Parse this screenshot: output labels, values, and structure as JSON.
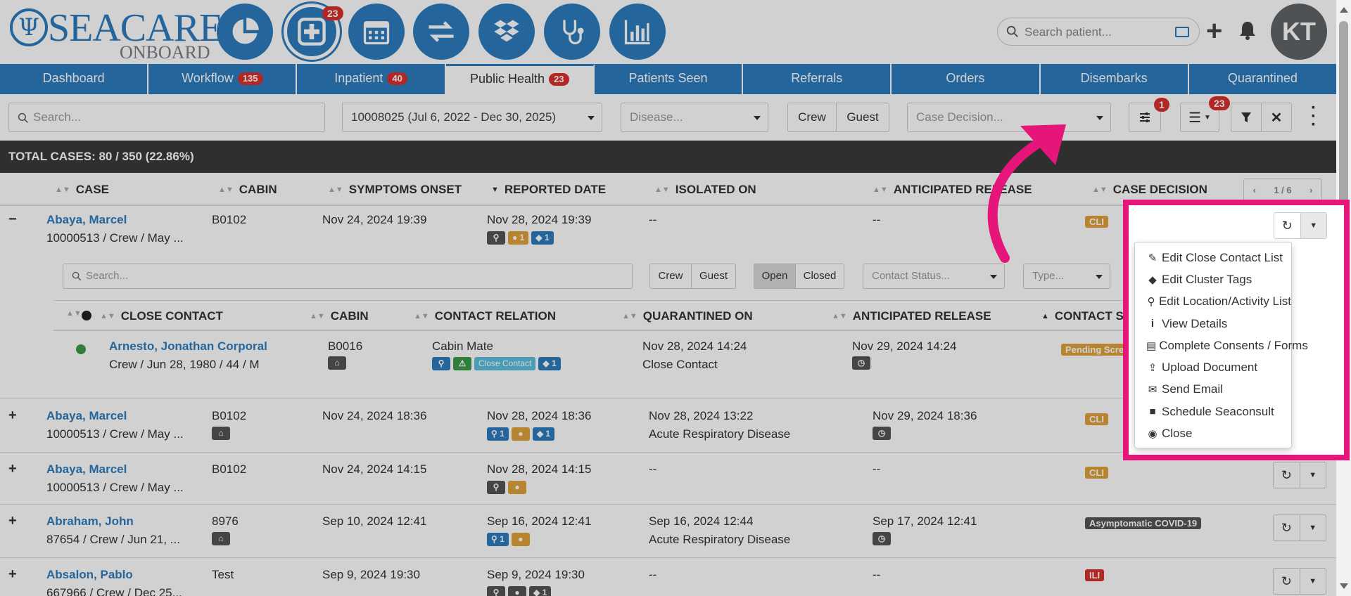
{
  "header": {
    "logo_main": "SEACARE",
    "logo_sub": "ONBOARD",
    "logo_symbol": "Ψ",
    "nav_icons": [
      {
        "name": "dashboard-pie-icon"
      },
      {
        "name": "medical-plus-icon",
        "badge": "23"
      },
      {
        "name": "calendar-icon"
      },
      {
        "name": "transfer-arrows-icon"
      },
      {
        "name": "dropbox-icon"
      },
      {
        "name": "stethoscope-icon"
      },
      {
        "name": "bar-chart-icon"
      }
    ],
    "search_placeholder": "Search patient...",
    "avatar_initials": "KT"
  },
  "tabs": [
    {
      "label": "Dashboard",
      "count": ""
    },
    {
      "label": "Workflow",
      "count": "135"
    },
    {
      "label": "Inpatient",
      "count": "40"
    },
    {
      "label": "Public Health",
      "count": "23",
      "active": true
    },
    {
      "label": "Patients Seen",
      "count": ""
    },
    {
      "label": "Referrals",
      "count": ""
    },
    {
      "label": "Orders",
      "count": ""
    },
    {
      "label": "Disembarks",
      "count": ""
    },
    {
      "label": "Quarantined",
      "count": ""
    }
  ],
  "filters": {
    "search_placeholder": "Search...",
    "voyage": "10008025 (Jul 6, 2022 - Dec 30, 2025)",
    "disease_placeholder": "Disease...",
    "crew_label": "Crew",
    "guest_label": "Guest",
    "case_decision_placeholder": "Case Decision...",
    "settings_badge": "1",
    "list_badge": "23"
  },
  "total_cases": "TOTAL CASES: 80 / 350 (22.86%)",
  "columns": [
    "CASE",
    "CABIN",
    "SYMPTOMS ONSET",
    "REPORTED DATE",
    "ISOLATED ON",
    "ANTICIPATED RELEASE",
    "CASE DECISION"
  ],
  "pager": {
    "prev": "‹",
    "label": "1 / 6",
    "next": "›"
  },
  "rows": [
    {
      "toggle": "−",
      "name": "Abaya, Marcel",
      "sub": "10000513 / Crew / May ...",
      "cabin": "B0102",
      "onset": "Nov 24, 2024 19:39",
      "reported": "Nov 28, 2024 19:39",
      "isolated": "--",
      "isolated_sub": "",
      "release": "--",
      "decision": "CLI",
      "decision_color": "#e0a23a"
    },
    {
      "toggle": "+",
      "name": "Abaya, Marcel",
      "sub": "10000513 / Crew / May ...",
      "cabin": "B0102",
      "onset": "Nov 24, 2024 18:36",
      "reported": "Nov 28, 2024 18:36",
      "isolated": "Nov 28, 2024 13:22",
      "isolated_sub": "Acute Respiratory Disease",
      "release": "Nov 29, 2024 18:36",
      "decision": "CLI",
      "decision_color": "#e0a23a"
    },
    {
      "toggle": "+",
      "name": "Abaya, Marcel",
      "sub": "10000513 / Crew / May ...",
      "cabin": "B0102",
      "onset": "Nov 24, 2024 14:15",
      "reported": "Nov 28, 2024 14:15",
      "isolated": "--",
      "isolated_sub": "",
      "release": "--",
      "decision": "CLI",
      "decision_color": "#e0a23a"
    },
    {
      "toggle": "+",
      "name": "Abraham, John",
      "sub": "87654 / Crew / Jun 21, ...",
      "cabin": "8976",
      "onset": "Sep 10, 2024 12:41",
      "reported": "Sep 16, 2024 12:41",
      "isolated": "Sep 16, 2024 12:44",
      "isolated_sub": "Acute Respiratory Disease",
      "release": "Sep 17, 2024 12:41",
      "decision": "Asymptomatic COVID-19",
      "decision_color": "#555555"
    },
    {
      "toggle": "+",
      "name": "Absalon, Pablo",
      "sub": "667966 / Crew / Dec 25...",
      "cabin": "Test",
      "onset": "Sep 9, 2024 19:30",
      "reported": "Sep 9, 2024 19:30",
      "isolated": "--",
      "isolated_sub": "",
      "release": "--",
      "decision": "ILI",
      "decision_color": "#d9302c"
    }
  ],
  "row_chips": {
    "r0": [
      "1",
      "1"
    ],
    "r1": [
      "1",
      "1"
    ],
    "r4": [
      "1"
    ]
  },
  "close_contacts": {
    "search_placeholder": "Search...",
    "crew_label": "Crew",
    "guest_label": "Guest",
    "open_label": "Open",
    "closed_label": "Closed",
    "contact_status_placeholder": "Contact Status...",
    "type_placeholder": "Type...",
    "columns": [
      "CLOSE CONTACT",
      "CABIN",
      "CONTACT RELATION",
      "QUARANTINED ON",
      "ANTICIPATED RELEASE",
      "CONTACT STATUS"
    ],
    "contact": {
      "name": "Arnesto, Jonathan Corporal",
      "sub": "Crew / Jun 28, 1980 / 44 / M",
      "cabin": "B0016",
      "relation": "Cabin Mate",
      "relation_tag": "Close Contact",
      "relation_count": "1",
      "quarantined": "Nov 28, 2024 14:24",
      "quarantined_sub": "Close Contact",
      "release": "Nov 29, 2024 14:24",
      "status": "Pending Scre"
    }
  },
  "menu": [
    {
      "label": "Edit Close Contact List",
      "icon": "edit-icon"
    },
    {
      "label": "Edit Cluster Tags",
      "icon": "tags-icon"
    },
    {
      "label": "Edit Location/Activity List",
      "icon": "map-marker-icon"
    },
    {
      "label": "View Details",
      "icon": "info-icon"
    },
    {
      "label": "Complete Consents / Forms",
      "icon": "file-icon"
    },
    {
      "label": "Upload Document",
      "icon": "upload-icon"
    },
    {
      "label": "Send Email",
      "icon": "envelope-icon"
    },
    {
      "label": "Schedule Seaconsult",
      "icon": "video-icon"
    },
    {
      "label": "Close",
      "icon": "close-circle-icon"
    }
  ],
  "colors": {
    "brand": "#2d7dbf",
    "badge": "#d9302c",
    "highlight": "#e6157a"
  }
}
